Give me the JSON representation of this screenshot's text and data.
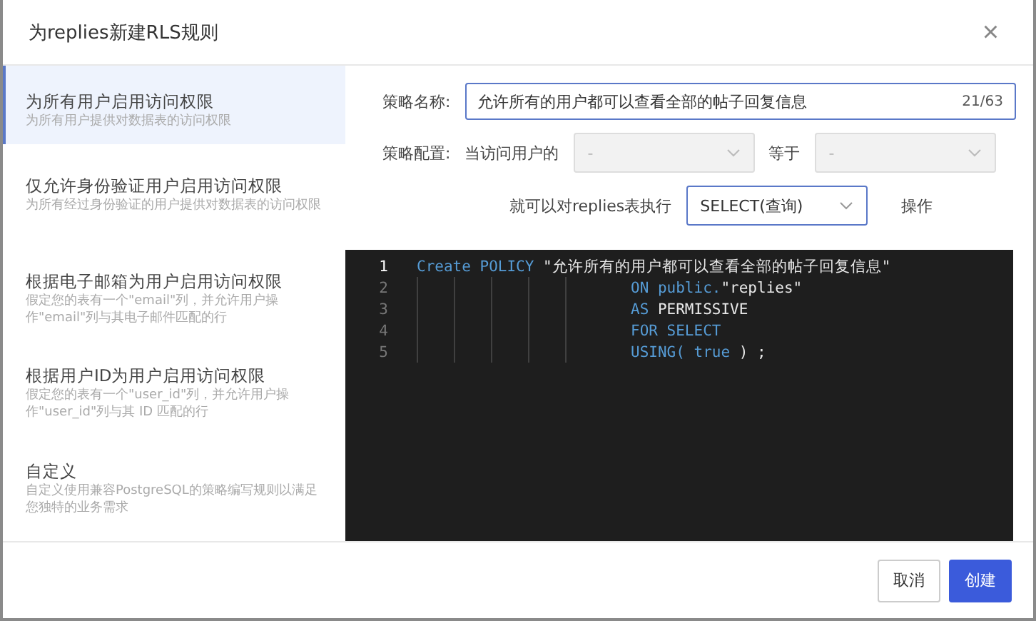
{
  "dialog": {
    "title": "为replies新建RLS规则",
    "close": "×"
  },
  "templates": [
    {
      "title": "为所有用户启用访问权限",
      "description": "为所有用户提供对数据表的访问权限",
      "selected": true
    },
    {
      "title": "仅允许身份验证用户启用访问权限",
      "description": "为所有经过身份验证的用户提供对数据表的访问权限",
      "selected": false
    },
    {
      "title": "根据电子邮箱为用户启用访问权限",
      "description": "假定您的表有一个\"email\"列，并允许用户操作\"email\"列与其电子邮件匹配的行",
      "selected": false
    },
    {
      "title": "根据用户ID为用户启用访问权限",
      "description": "假定您的表有一个\"user_id\"列，并允许用户操作\"user_id\"列与其 ID 匹配的行",
      "selected": false
    },
    {
      "title": "自定义",
      "description": "自定义使用兼容PostgreSQL的策略编写规则以满足您独特的业务需求",
      "selected": false
    }
  ],
  "form": {
    "name_label": "策略名称:",
    "name_value": "允许所有的用户都可以查看全部的帖子回复信息",
    "name_count": "21/63",
    "config_label": "策略配置:",
    "when_label": "当访问用户的",
    "when_value": "-",
    "equals_label": "等于",
    "equals_value": "-",
    "action_label": "就可以对replies表执行",
    "action_value": "SELECT(查询)",
    "action_suffix": "操作"
  },
  "code": [
    {
      "number": "1",
      "active": true,
      "indent": false,
      "tokens": [
        {
          "kind": "keyword",
          "text": "Create POLICY"
        },
        {
          "kind": "string",
          "text": " \"允许所有的用户都可以查看全部的帖子回复信息\""
        }
      ]
    },
    {
      "number": "2",
      "active": false,
      "indent": true,
      "tokens": [
        {
          "kind": "keyword",
          "text": "ON public."
        },
        {
          "kind": "string",
          "text": "\"replies\""
        }
      ]
    },
    {
      "number": "3",
      "active": false,
      "indent": true,
      "tokens": [
        {
          "kind": "keyword",
          "text": "AS "
        },
        {
          "kind": "string",
          "text": "PERMISSIVE"
        }
      ]
    },
    {
      "number": "4",
      "active": false,
      "indent": true,
      "tokens": [
        {
          "kind": "keyword",
          "text": "FOR SELECT"
        }
      ]
    },
    {
      "number": "5",
      "active": false,
      "indent": true,
      "tokens": [
        {
          "kind": "keyword",
          "text": "USING( true"
        },
        {
          "kind": "string",
          "text": " ) ;"
        }
      ]
    }
  ],
  "buttons": [
    {
      "label": "取消",
      "kind": "secondary"
    },
    {
      "label": "创建",
      "kind": "primary"
    }
  ]
}
